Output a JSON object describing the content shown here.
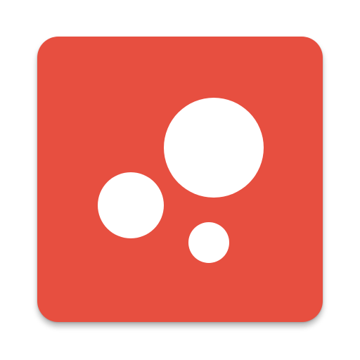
{
  "icon": {
    "name": "app-icon",
    "background_color": "#E74F40",
    "circle_color": "#FFFFFF"
  }
}
